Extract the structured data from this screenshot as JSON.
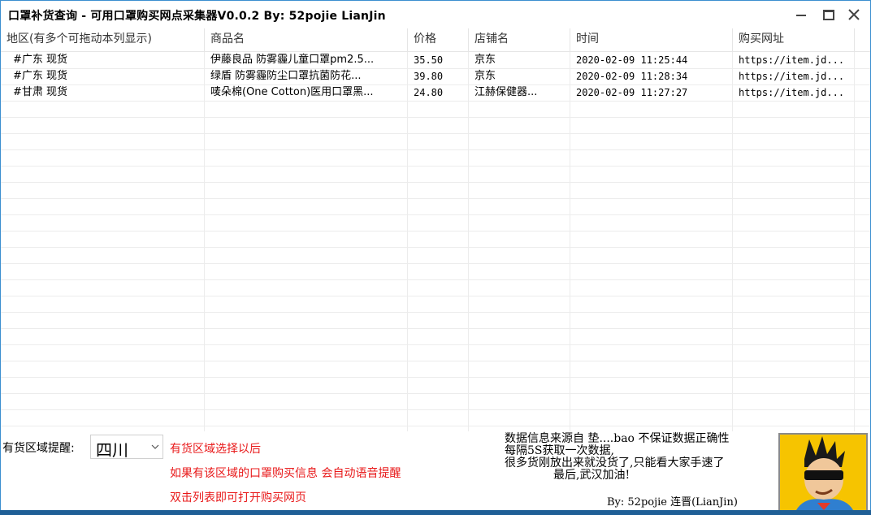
{
  "window": {
    "title": "口罩补货查询 - 可用口罩购买网点采集器V0.0.2 By: 52pojie  LianJin"
  },
  "listview": {
    "columns": [
      "地区(有多个可拖动本列显示)",
      "商品名",
      "价格",
      "店铺名",
      "时间",
      "购买网址"
    ],
    "rows": [
      [
        "#广东 现货",
        "伊藤良品 防雾霾儿童口罩pm2.5...",
        "35.50",
        "京东",
        "2020-02-09 11:25:44",
        "https://item.jd..."
      ],
      [
        "#广东 现货",
        "绿盾 防雾霾防尘口罩抗菌防花...",
        "39.80",
        "京东",
        "2020-02-09 11:28:34",
        "https://item.jd..."
      ],
      [
        "#甘肃 现货",
        "唛朵棉(One Cotton)医用口罩黑...",
        "24.80",
        "江赫保健器...",
        "2020-02-09 11:27:27",
        "https://item.jd..."
      ]
    ]
  },
  "bottom": {
    "region_label": "有货区域提醒:",
    "region_value": "四川",
    "tips": [
      "有货区域选择以后",
      "如果有该区域的口罩购买信息 会自动语音提醒",
      "双击列表即可打开购买网页"
    ],
    "info_lines": [
      "数据信息来源自   垫....bao 不保证数据正确性",
      "每隔5S获取一次数据,",
      "很多货刚放出来就没货了,只能看大家手速了",
      "最后,武汉加油!"
    ],
    "author": "By: 52pojie 连晋(LianJin)"
  },
  "colors": {
    "window_border": "#3c8fd0",
    "tip_red": "#e8191a",
    "avatar_bg": "#f6c400"
  }
}
